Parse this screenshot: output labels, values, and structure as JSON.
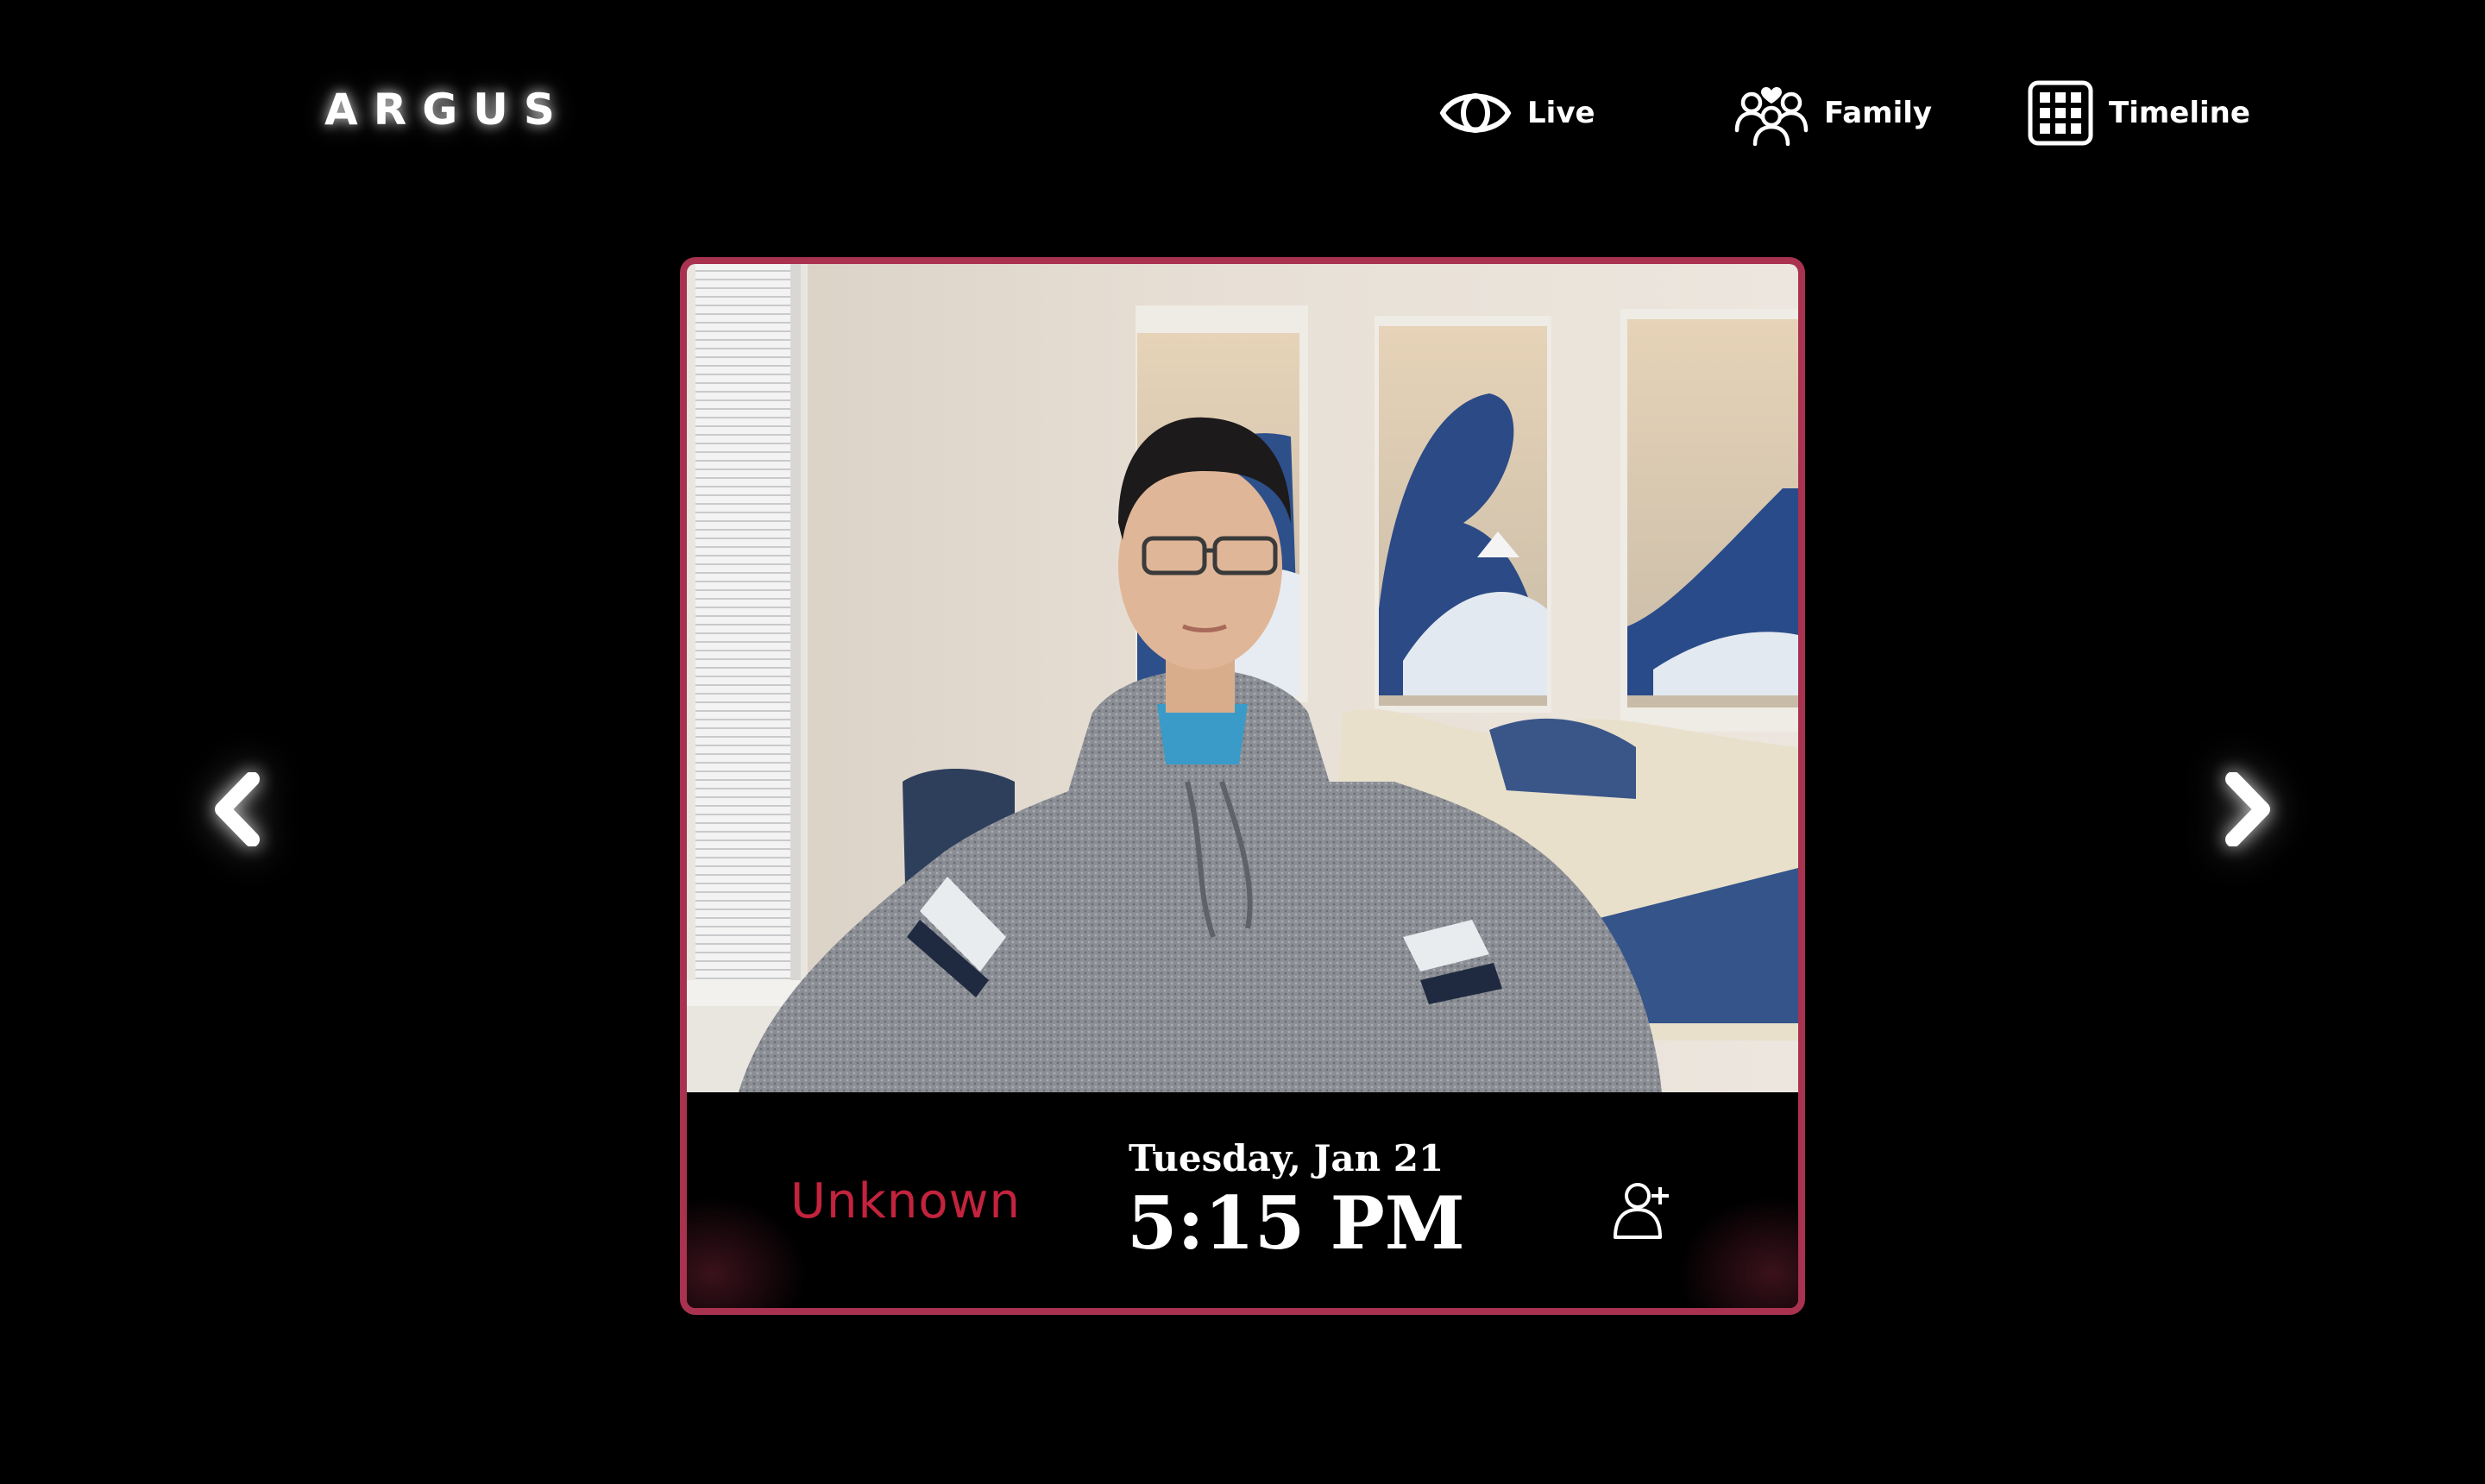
{
  "header": {
    "logo": "ARGUS",
    "nav": [
      {
        "label": "Live",
        "icon": "eye-icon"
      },
      {
        "label": "Family",
        "icon": "family-icon"
      },
      {
        "label": "Timeline",
        "icon": "grid-icon"
      }
    ]
  },
  "navigation": {
    "prev_icon": "chevron-left-icon",
    "next_icon": "chevron-right-icon"
  },
  "event": {
    "status": "Unknown",
    "date": "Tuesday, Jan 21",
    "time": "5:15 PM",
    "add_person_icon": "add-person-icon"
  },
  "colors": {
    "background": "#000000",
    "card_border": "#a8324f",
    "status_text": "#c3233d",
    "text": "#ffffff"
  }
}
